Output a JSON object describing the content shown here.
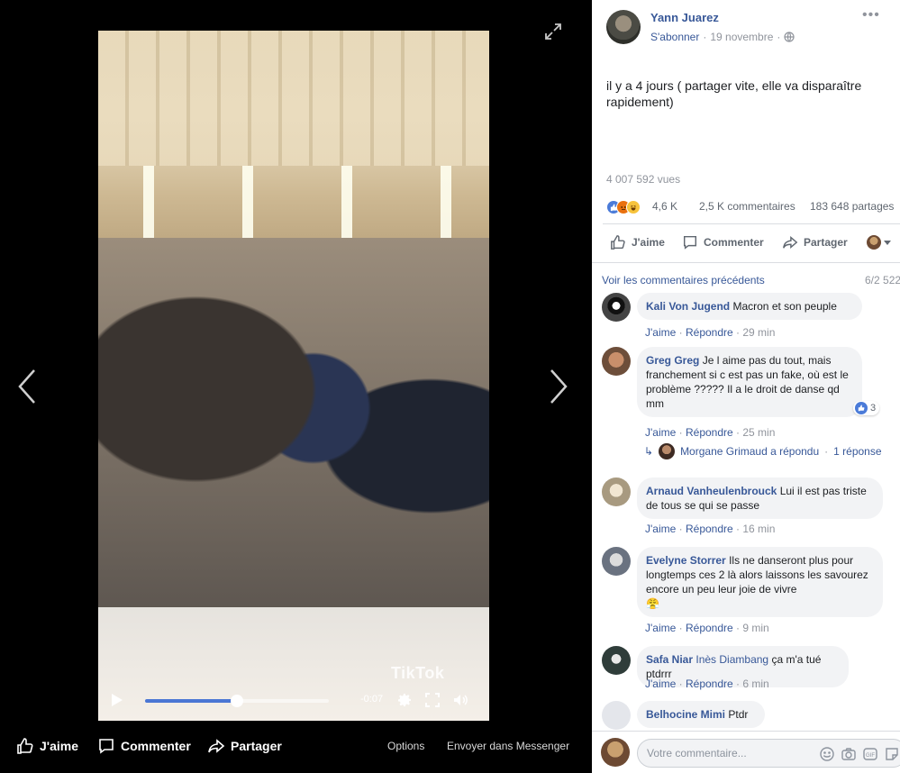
{
  "theater": {
    "player": {
      "time_remaining": "-0:07",
      "progress": 0.5,
      "watermark": "TikTok"
    },
    "actions": {
      "like_label": "J'aime",
      "comment_label": "Commenter",
      "share_label": "Partager",
      "options_label": "Options",
      "messenger_label": "Envoyer dans Messenger"
    }
  },
  "post": {
    "author": "Yann Juarez",
    "subscribe_label": "S'abonner",
    "separator": "·",
    "date": "19 novembre",
    "text": "il y a 4 jours ( partager vite, elle va disparaître rapidement)",
    "views": "4 007 592 vues",
    "reaction_count": "4,6 K",
    "comments_count": "2,5 K commentaires",
    "shares_count": "183 648 partages",
    "actions": {
      "like_label": "J'aime",
      "comment_label": "Commenter",
      "share_label": "Partager"
    }
  },
  "comments": {
    "previous_link": "Voir les commentaires précédents",
    "counter": "6/2 522",
    "items": [
      {
        "author": "Kali Von Jugend",
        "text": "Macron et son peuple",
        "like": "J'aime",
        "reply": "Répondre",
        "time": "29 min"
      },
      {
        "author": "Greg Greg",
        "text": "Je l aime pas du tout, mais franchement si c est pas un fake, où est le problème ????? Il a le droit de danse qd mm",
        "like": "J'aime",
        "reply": "Répondre",
        "time": "25 min",
        "likes": "3"
      },
      {
        "author": "Arnaud Vanheulenbrouck",
        "text": "Lui il est pas triste de tous se qui se passe",
        "like": "J'aime",
        "reply": "Répondre",
        "time": "16 min"
      },
      {
        "author": "Evelyne Storrer",
        "text": "Ils ne danseront plus pour longtemps ces 2 là alors laissons les savourez encore un peu leur joie de vivre",
        "emoji": "😤",
        "like": "J'aime",
        "reply": "Répondre",
        "time": "9 min"
      },
      {
        "author": "Safa Niar",
        "tag": "Inès Diambang",
        "text": "ça m'a tué ptdrrr",
        "like": "J'aime",
        "reply": "Répondre",
        "time": "6 min"
      },
      {
        "author": "Belhocine Mimi",
        "text": "Ptdr"
      }
    ],
    "reply_summary": {
      "who": "Morgane Grimaud a répondu",
      "count": "1 réponse"
    }
  },
  "composer": {
    "placeholder": "Votre commentaire..."
  },
  "colors": {
    "link": "#385898",
    "muted": "#90949c",
    "bubble": "#f2f3f5",
    "like_blue": "#4b7bd8"
  },
  "icons": [
    "expand-icon",
    "chevron-left-icon",
    "chevron-right-icon",
    "play-icon",
    "settings-icon",
    "fullscreen-icon",
    "volume-icon",
    "thumbs-up-icon",
    "comment-icon",
    "share-icon",
    "globe-icon",
    "more-icon",
    "emoji-icon",
    "camera-icon",
    "gif-icon",
    "sticker-icon"
  ]
}
